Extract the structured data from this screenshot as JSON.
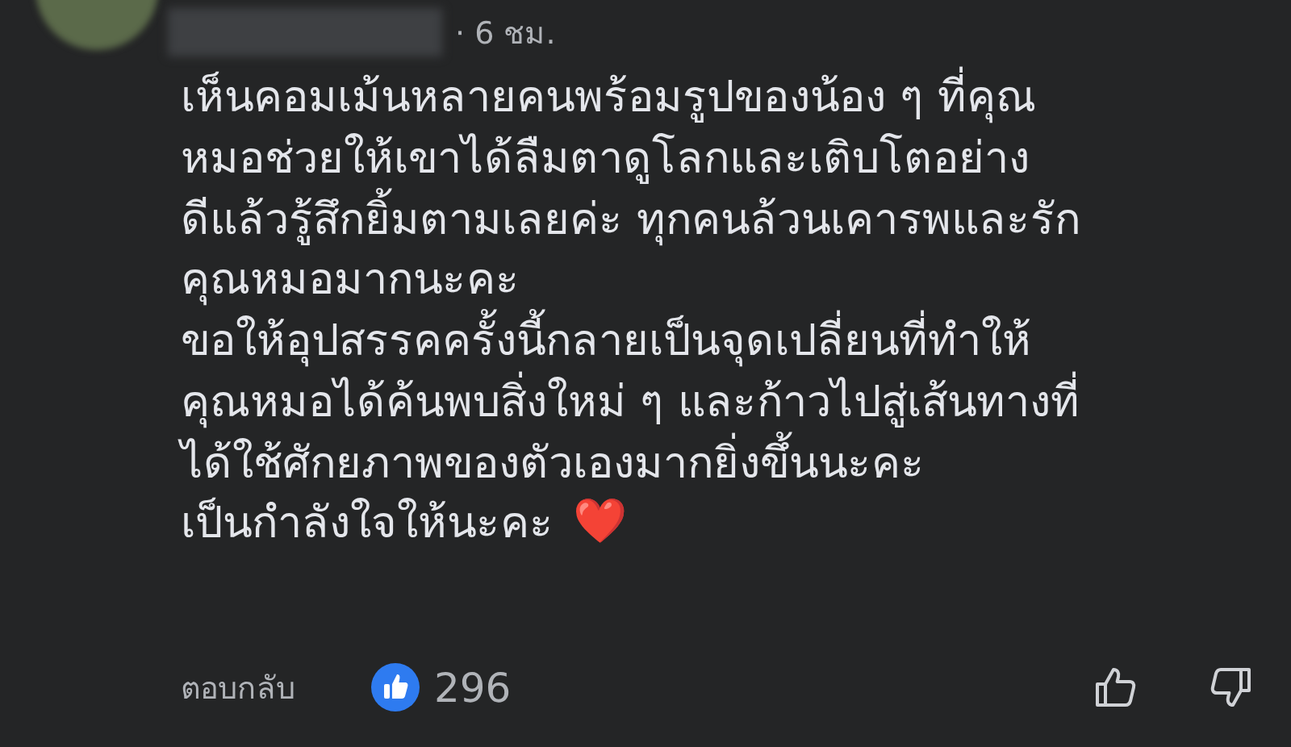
{
  "comment": {
    "time": "· 6 ชม.",
    "lines": [
      "เห็นคอมเม้นหลายคนพร้อมรูปของน้อง ๆ ที่คุณ",
      "หมอช่วยให้เขาได้ลืมตาดูโลกและเติบโตอย่าง",
      "ดีแล้วรู้สึกยิ้มตามเลยค่ะ ทุกคนล้วนเคารพและรัก",
      "คุณหมอมากนะคะ",
      "ขอให้อุปสรรคครั้งนี้กลายเป็นจุดเปลี่ยนที่ทำให้",
      "คุณหมอได้ค้นพบสิ่งใหม่ ๆ และก้าวไปสู่เส้นทางที่",
      "ได้ใช้ศักยภาพของตัวเองมากยิ่งขึ้นนะคะ",
      "เป็นกำลังใจให้นะคะ"
    ],
    "emoji": "❤️"
  },
  "actions": {
    "reply": "ตอบกลับ",
    "like_count": "296"
  }
}
